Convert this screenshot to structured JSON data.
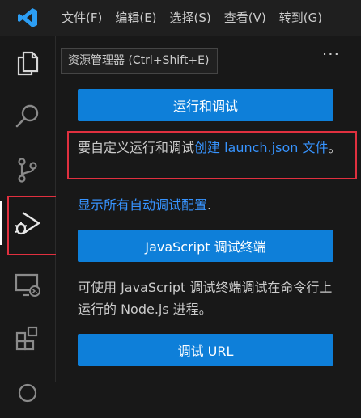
{
  "menubar": {
    "logo_icon": "vscode-logo-icon",
    "items": [
      "文件(F)",
      "编辑(E)",
      "选择(S)",
      "查看(V)",
      "转到(G)"
    ]
  },
  "activitybar": {
    "items": [
      {
        "name": "explorer",
        "icon": "files-icon"
      },
      {
        "name": "search",
        "icon": "search-icon"
      },
      {
        "name": "source-control",
        "icon": "source-control-icon"
      },
      {
        "name": "run-and-debug",
        "icon": "run-debug-icon",
        "active": true
      },
      {
        "name": "remote-explorer",
        "icon": "remote-explorer-icon"
      },
      {
        "name": "extensions",
        "icon": "extensions-icon"
      }
    ]
  },
  "sidebar": {
    "tooltip": "资源管理器 (Ctrl+Shift+E)",
    "more": "···",
    "run_debug_button": "运行和调试",
    "customize_text": "要自定义运行和调试",
    "create_link": "创建 launch.json 文件",
    "customize_suffix": "。",
    "show_all_link": "显示所有自动调试配置",
    "show_all_suffix": ".",
    "js_terminal_button": "JavaScript 调试终端",
    "js_terminal_desc": "可使用 JavaScript 调试终端调试在命令行上运行的 Node.js 进程。",
    "debug_url_button": "调试 URL"
  },
  "colors": {
    "accent": "#0e7fd9",
    "link": "#3794ff",
    "highlight": "#e0303f"
  }
}
